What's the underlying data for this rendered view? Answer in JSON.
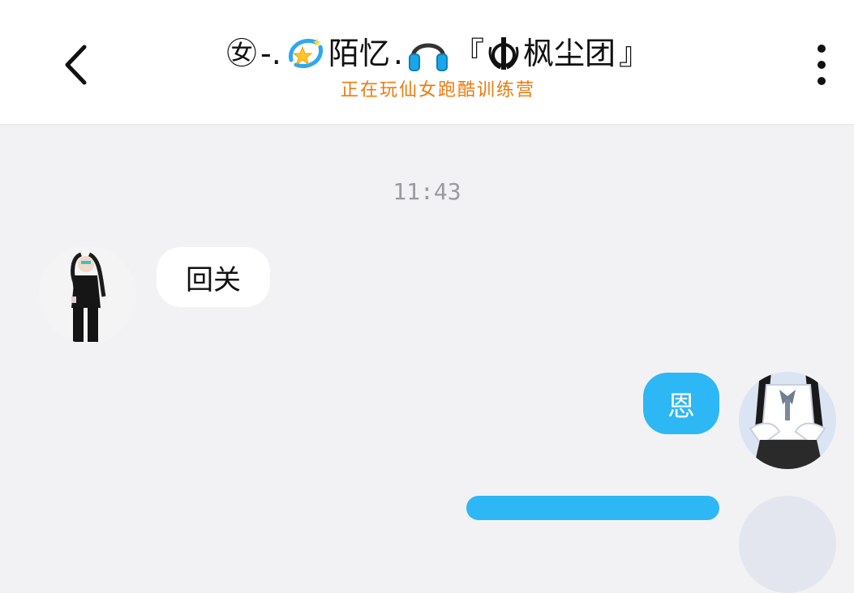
{
  "header": {
    "title_parts": {
      "badge": "㊛",
      "dash": "-.",
      "name": "陌忆",
      "sep": ".",
      "bracket_open": "『",
      "group": "枫尘团",
      "bracket_close": "』"
    },
    "subtitle": "正在玩仙女跑酷训练营",
    "subtitle_color": "#ee7a0e",
    "back_icon": "chevron-left-icon",
    "more_icon": "more-vertical-icon"
  },
  "chat": {
    "timestamp": "11:43",
    "messages": [
      {
        "direction": "incoming",
        "text": "回关",
        "avatar_icon": "user-avatar-icon"
      },
      {
        "direction": "outgoing",
        "text": "恩",
        "avatar_icon": "user-avatar-icon",
        "bubble_color": "#2db7f5"
      }
    ]
  }
}
